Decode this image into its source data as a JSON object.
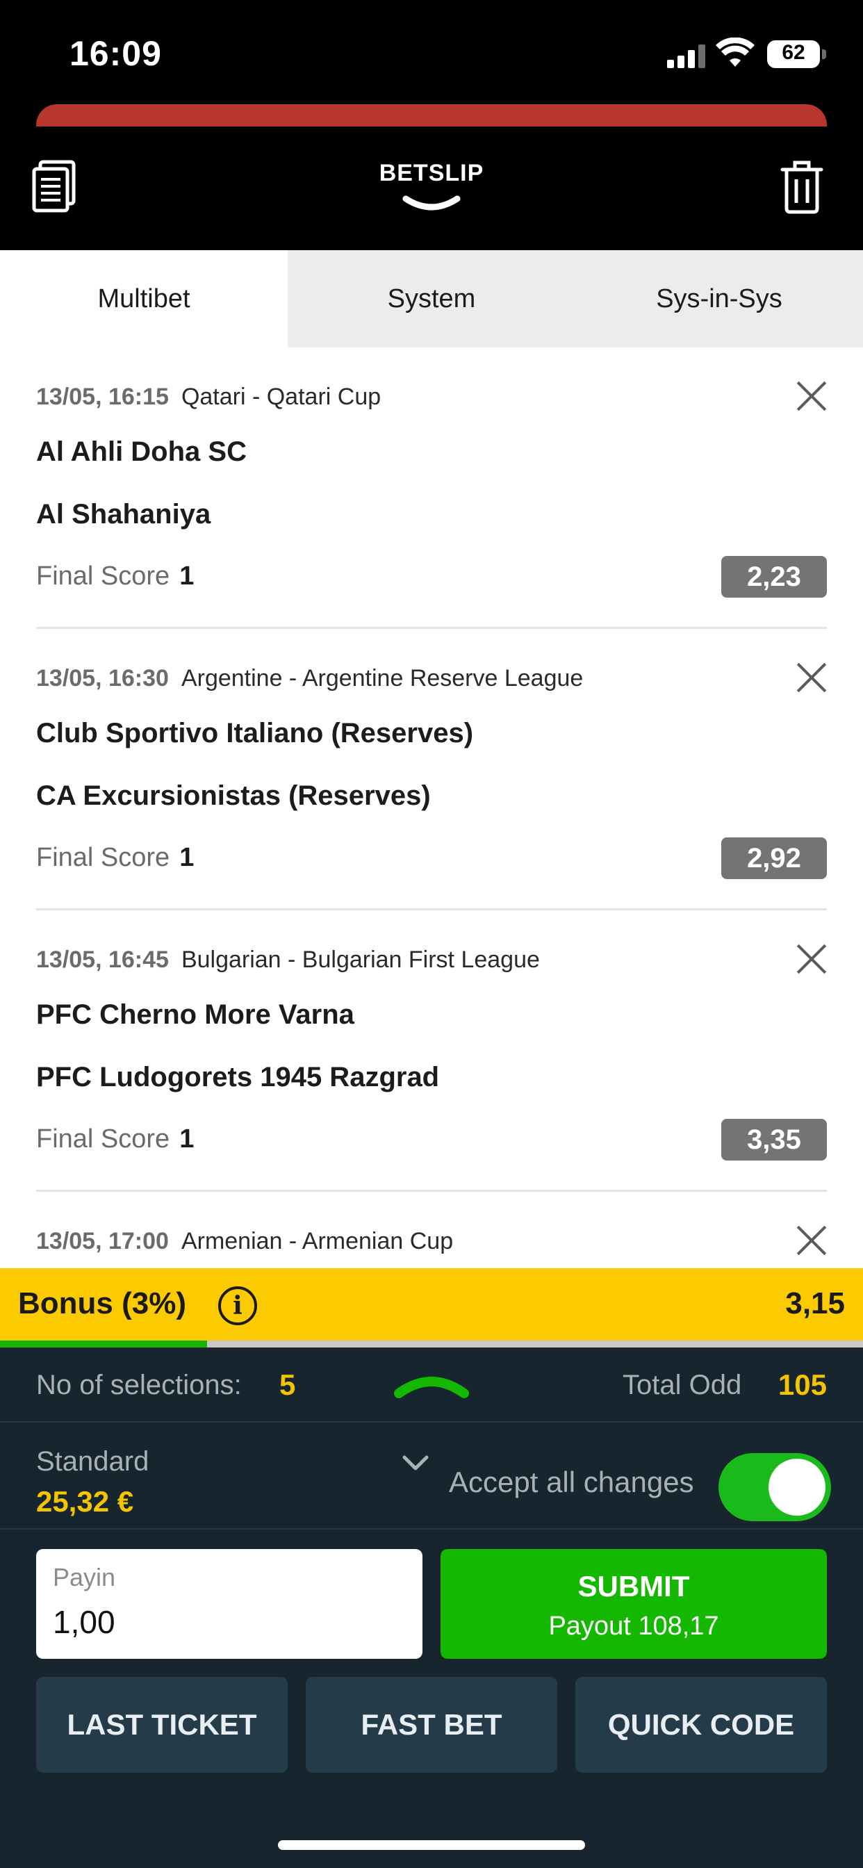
{
  "status_bar": {
    "time": "16:09",
    "battery": "62"
  },
  "header": {
    "title": "BETSLIP"
  },
  "tabs": [
    {
      "label": "Multibet",
      "active": true
    },
    {
      "label": "System",
      "active": false
    },
    {
      "label": "Sys-in-Sys",
      "active": false
    }
  ],
  "selections": [
    {
      "datetime": "13/05, 16:15",
      "league": "Qatari - Qatari Cup",
      "team1": "Al Ahli Doha SC",
      "team2": "Al Shahaniya",
      "market": "Final Score",
      "pick": "1",
      "odd": "2,23"
    },
    {
      "datetime": "13/05, 16:30",
      "league": "Argentine - Argentine Reserve League",
      "team1": "Club Sportivo Italiano (Reserves)",
      "team2": "CA Excursionistas (Reserves)",
      "market": "Final Score",
      "pick": "1",
      "odd": "2,92"
    },
    {
      "datetime": "13/05, 16:45",
      "league": "Bulgarian - Bulgarian First League",
      "team1": "PFC Cherno More Varna",
      "team2": "PFC Ludogorets 1945 Razgrad",
      "market": "Final Score",
      "pick": "1",
      "odd": "3,35"
    },
    {
      "datetime": "13/05, 17:00",
      "league": "Armenian - Armenian Cup",
      "team1": "",
      "team2": "",
      "market": "",
      "pick": "",
      "odd": ""
    }
  ],
  "bonus": {
    "label": "Bonus (3%)",
    "value": "3,15",
    "progress": 0.24
  },
  "summary": {
    "selections_label": "No of selections:",
    "selections_count": "5",
    "total_odd_label": "Total Odd",
    "total_odd": "105"
  },
  "stake_type": {
    "label": "Standard",
    "amount": "25,32 €"
  },
  "accept_changes": {
    "label": "Accept all changes",
    "enabled": true
  },
  "payin": {
    "label": "Payin",
    "value": "1,00"
  },
  "submit": {
    "label": "SUBMIT",
    "payout": "Payout 108,17"
  },
  "actions": {
    "last_ticket": "LAST TICKET",
    "fast_bet": "FAST BET",
    "quick_code": "QUICK CODE"
  },
  "colors": {
    "accent_yellow": "#fbca00",
    "accent_green": "#14b800",
    "panel_dark": "#17262e",
    "odd_gray": "#747474",
    "header_red": "#b8372c"
  }
}
